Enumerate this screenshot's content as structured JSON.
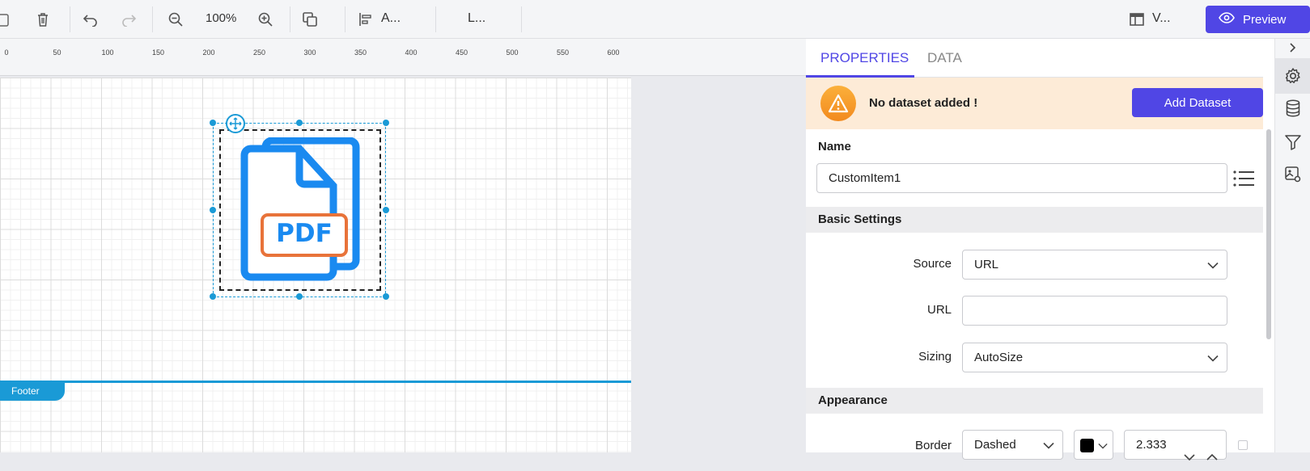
{
  "toolbar": {
    "zoom": "100%",
    "align_label": "A...",
    "layout_label": "L...",
    "view_label": "V...",
    "preview_label": "Preview"
  },
  "ruler": {
    "ticks": [
      "0",
      "50",
      "100",
      "150",
      "200",
      "250",
      "300",
      "350",
      "400",
      "450",
      "500",
      "550",
      "600"
    ]
  },
  "canvas": {
    "footer_label": "Footer",
    "item_text": "PDF"
  },
  "panel": {
    "tabs": [
      {
        "label": "PROPERTIES",
        "active": true
      },
      {
        "label": "DATA",
        "active": false
      }
    ],
    "alert": {
      "text": "No dataset added !",
      "button_label": "Add Dataset"
    },
    "name": {
      "label": "Name",
      "value": "CustomItem1"
    },
    "basic_settings": {
      "title": "Basic Settings",
      "source_label": "Source",
      "source_value": "URL",
      "url_label": "URL",
      "url_value": "",
      "sizing_label": "Sizing",
      "sizing_value": "AutoSize"
    },
    "appearance": {
      "title": "Appearance",
      "border_label": "Border",
      "border_style": "Dashed",
      "border_color": "#000000",
      "border_width": "2.333"
    }
  },
  "colors": {
    "accent": "#5046e5",
    "selection": "#1a9ad6",
    "pdf_blue": "#1a8af0",
    "pdf_orange": "#e8733a",
    "alert_bg": "#fdebd7"
  }
}
